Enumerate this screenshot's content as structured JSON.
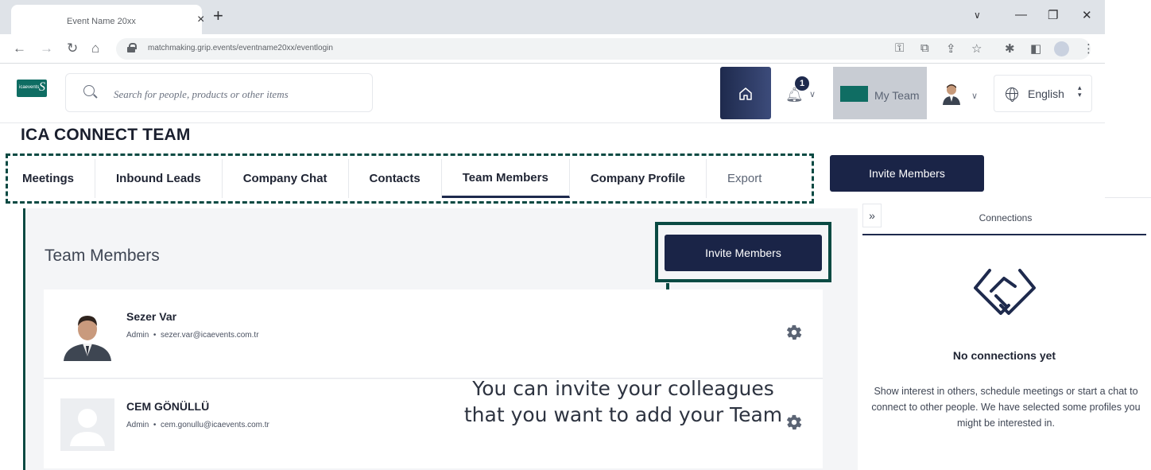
{
  "browser": {
    "tab_title": "Event Name 20xx",
    "tab_close": "×",
    "new_tab": "+",
    "url": "matchmaking.grip.events/eventname20xx/eventlogin",
    "controls": {
      "dropdown": "∨",
      "minimize": "—",
      "restore": "❐",
      "close": "✕"
    }
  },
  "header": {
    "logo_text": "icaevents",
    "search_placeholder": "Search for people, products or other items",
    "notification_count": "1",
    "my_team_label": "My Team",
    "language": "English"
  },
  "page": {
    "team_title": "ICA CONNECT TEAM",
    "tabs": [
      {
        "label": "Meetings"
      },
      {
        "label": "Inbound Leads"
      },
      {
        "label": "Company Chat"
      },
      {
        "label": "Contacts"
      },
      {
        "label": "Team Members",
        "active": true
      },
      {
        "label": "Company Profile"
      },
      {
        "label": "Export"
      }
    ],
    "invite_top_label": "Invite Members"
  },
  "main": {
    "title": "Team Members",
    "invite_label": "Invite Members",
    "members": [
      {
        "name": "Sezer Var",
        "role": "Admin",
        "separator": "•",
        "email": "sezer.var@icaevents.com.tr"
      },
      {
        "name": "CEM GÖNÜLLÜ",
        "role": "Admin",
        "separator": "•",
        "email": "cem.gonullu@icaevents.com.tr"
      }
    ],
    "helper_text": "You can invite your colleagues that you want to add your Team"
  },
  "connections": {
    "collapse_icon": "»",
    "title": "Connections",
    "empty_title": "No connections yet",
    "empty_description": "Show interest in others, schedule meetings or start a chat to connect to other people. We have selected some profiles you might be interested in."
  },
  "colors": {
    "navy": "#1a2447",
    "annotation_green": "#0a4a43",
    "brand_green": "#0f6d63",
    "panel_bg": "#f4f5f7"
  }
}
